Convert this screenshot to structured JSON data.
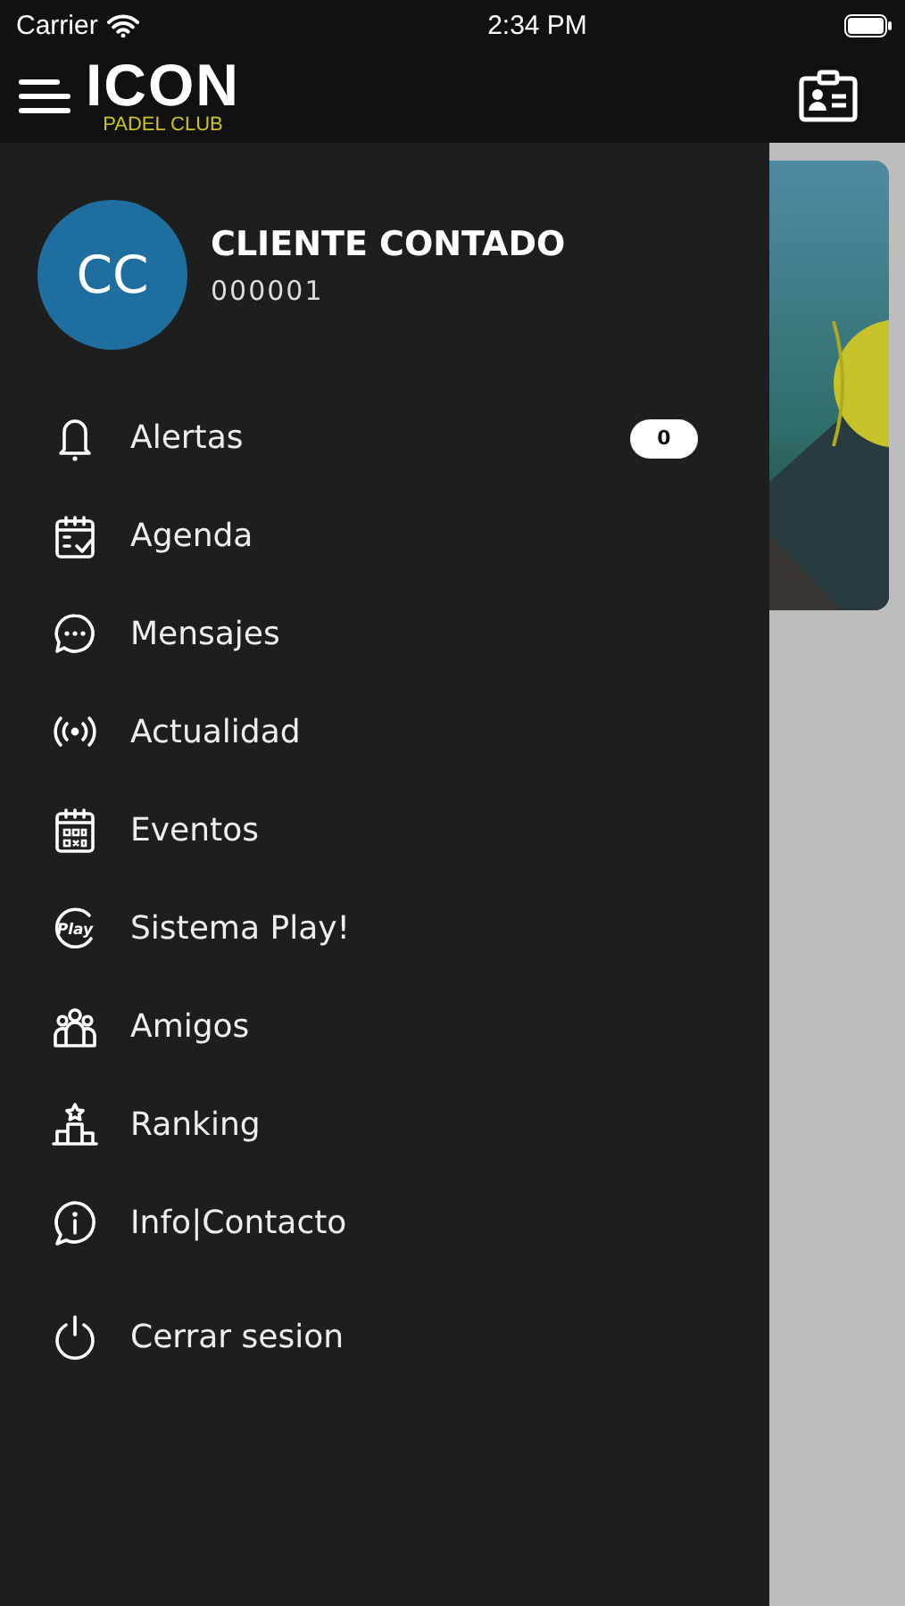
{
  "status_bar": {
    "carrier": "Carrier",
    "time": "2:34 PM"
  },
  "header": {
    "logo": "ICON",
    "logo_subtitle": "PADEL CLUB"
  },
  "profile": {
    "initials": "CC",
    "name": "CLIENTE CONTADO",
    "number": "000001"
  },
  "menu": [
    {
      "label": "Alertas",
      "badge": "0"
    },
    {
      "label": "Agenda"
    },
    {
      "label": "Mensajes"
    },
    {
      "label": "Actualidad"
    },
    {
      "label": "Eventos"
    },
    {
      "label": "Sistema Play!",
      "icon_text": "Play"
    },
    {
      "label": "Amigos"
    },
    {
      "label": "Ranking"
    },
    {
      "label": "Info|Contacto"
    }
  ],
  "logout": {
    "label": "Cerrar sesion"
  }
}
